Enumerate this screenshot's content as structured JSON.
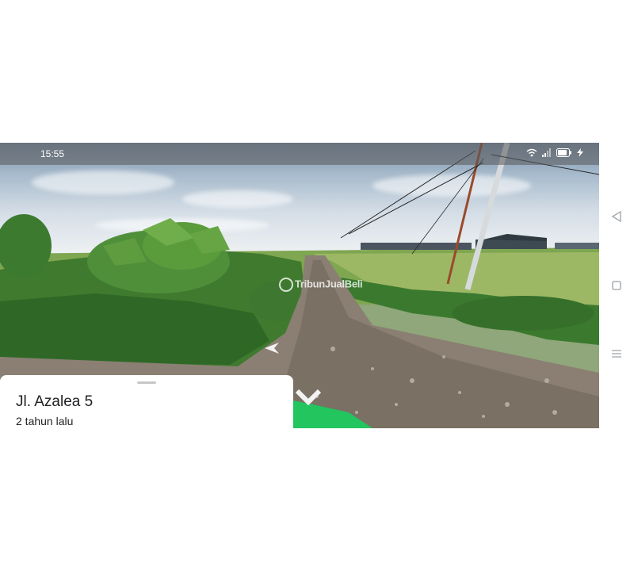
{
  "status_bar": {
    "time": "15:55"
  },
  "watermark": {
    "text": "TribunJualBeli"
  },
  "place_card": {
    "name": "Jl. Azalea 5",
    "date": "2 tahun lalu"
  },
  "icons": {
    "wifi": "wifi-icon",
    "signal": "signal-icon",
    "battery": "battery-icon",
    "charging": "charging-icon",
    "collapse": "fullscreen-exit-icon",
    "nav_back": "triangle-back-icon",
    "nav_home": "square-home-icon",
    "nav_menu": "menu-lines-icon"
  },
  "colors": {
    "accent_green": "#22c55e",
    "card_text": "#202124",
    "status_bar_bg": "#5a5a5a"
  }
}
